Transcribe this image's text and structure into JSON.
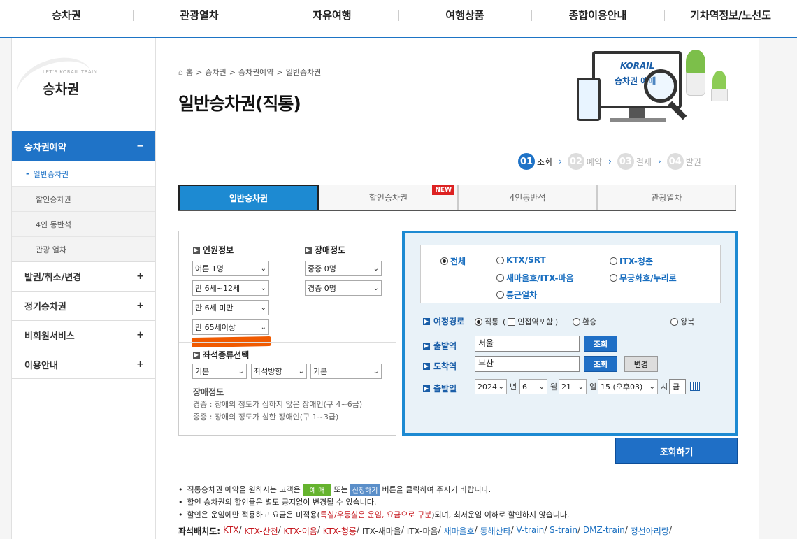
{
  "topnav": [
    "승차권",
    "관광열차",
    "자유여행",
    "여행상품",
    "종합이용안내",
    "기차역정보/노선도"
  ],
  "lnb": {
    "brand_sub": "LET'S KORAIL TRAIN",
    "title": "승차권",
    "menu": [
      {
        "label": "승차권예약",
        "icon": "−",
        "active": true
      },
      {
        "label": "발권/취소/변경",
        "icon": "+"
      },
      {
        "label": "정기승차권",
        "icon": "+"
      },
      {
        "label": "비회원서비스",
        "icon": "+"
      },
      {
        "label": "이용안내",
        "icon": "+"
      }
    ],
    "submenu": [
      "일반승차권",
      "할인승차권",
      "4인 동반석",
      "관광 열차"
    ]
  },
  "breadcrumb": [
    "홈",
    "승차권",
    "승차권예약",
    "일반승차권"
  ],
  "page_title": "일반승차권(직통)",
  "hero": {
    "brand": "KORAIL",
    "caption": "승차권 예매"
  },
  "steps": [
    {
      "num": "01",
      "label": "조회"
    },
    {
      "num": "02",
      "label": "예약"
    },
    {
      "num": "03",
      "label": "결제"
    },
    {
      "num": "04",
      "label": "발권"
    }
  ],
  "tabs": [
    {
      "label": "일반승차권"
    },
    {
      "label": "할인승차권",
      "badge": "NEW"
    },
    {
      "label": "4인동반석"
    },
    {
      "label": "관광열차"
    }
  ],
  "passengers": {
    "title": "인원정보",
    "adult": "어른 1명",
    "child": "만 6세~12세",
    "infant": "만 6세 미만",
    "senior": "만 65세이상"
  },
  "disability": {
    "title": "장애정도",
    "severe": "중증 0명",
    "mild": "경증 0명"
  },
  "seat": {
    "title": "좌석종류선택",
    "type": "기본",
    "direction": "좌석방향",
    "position": "기본"
  },
  "disability_note": {
    "title": "장애정도",
    "mild": "경증 : 장애의 정도가 심하지 않은 장애인(구 4~6급)",
    "severe": "중증 : 장애의 정도가 심한 장애인(구 1~3급)"
  },
  "train_types": [
    "전체",
    "KTX/SRT",
    "ITX-청춘",
    "새마을호/ITX-마음",
    "무궁화호/누리로",
    "통근열차"
  ],
  "route": {
    "label": "여정경로",
    "direct": "직통",
    "include": "인접역포함",
    "transfer": "환승",
    "round": "왕복"
  },
  "departure": {
    "label": "출발역",
    "value": "서울",
    "btn": "조회"
  },
  "arrival": {
    "label": "도착역",
    "value": "부산",
    "btn": "조회",
    "swap": "변경"
  },
  "date": {
    "label": "출발일",
    "year": "2024",
    "year_unit": "년",
    "month": "6",
    "month_unit": "월",
    "day": "21",
    "day_unit": "일",
    "hour": "15 (오후03)",
    "hour_unit": "시",
    "weekday": "금"
  },
  "search_button": "조회하기",
  "notices": {
    "n1a": "직통승차권 예약을 원하시는 고객은",
    "n1tag1": "예 매",
    "n1b": "또는",
    "n1tag2": "신청하기",
    "n1c": "버튼을 클릭하여 주시기 바랍니다.",
    "n2": "할인 승차권의 할인율은 별도 공지없이 변경될 수 있습니다.",
    "n3a": "할인은 운임에만 적용하고 요금은 미적용(",
    "n3red": "특실/우등실은 운임, 요금으로 구분",
    "n3b": ")되며, 최저운임 이하로 할인하지 않습니다."
  },
  "seatmap": {
    "label": "좌석배치도:",
    "links": [
      "KTX",
      "KTX-산천",
      "KTX-이음",
      "KTX-청룡",
      "ITX-새마을",
      "ITX-마음",
      "새마을호",
      "동해산타",
      "V-train",
      "S-train",
      "DMZ-train",
      "정선아리랑"
    ]
  },
  "colors": {
    "accent": "#1f73c7",
    "tab_active": "#1d8ad2",
    "highlight": "#f05a00"
  }
}
